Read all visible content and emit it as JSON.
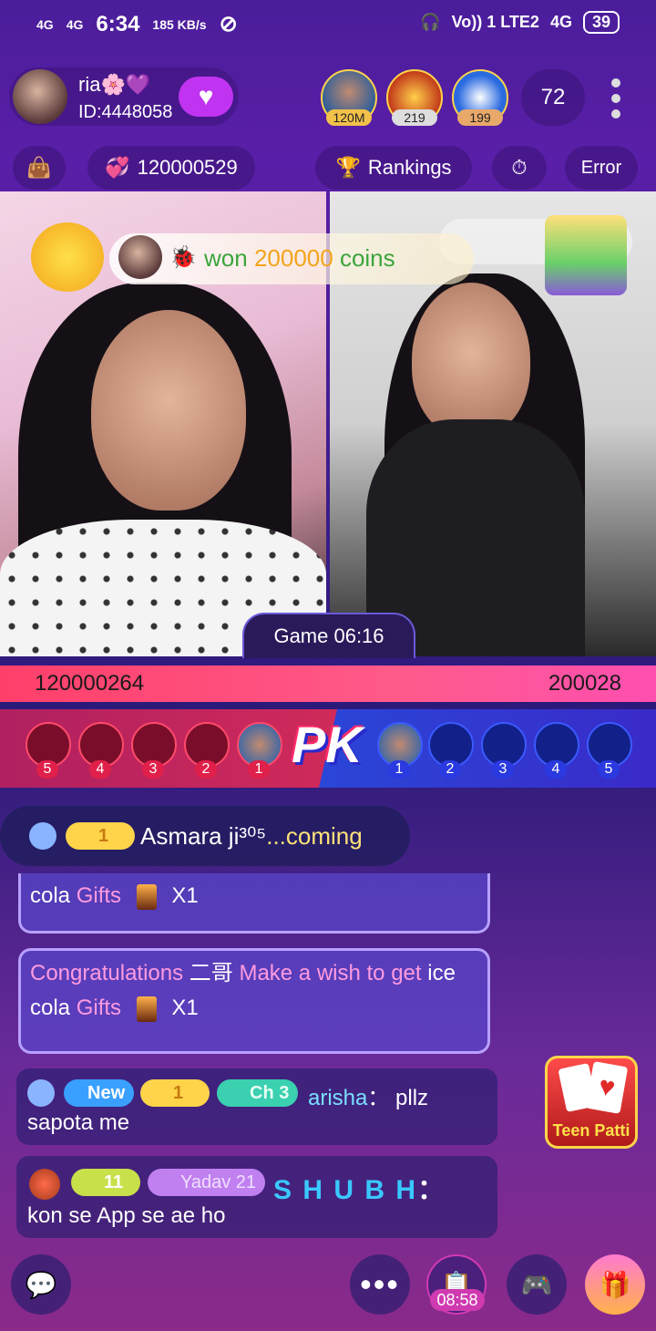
{
  "status_bar": {
    "signal1": "4G",
    "signal2": "4G",
    "time": "6:34",
    "speed": "185 KB/s",
    "network": "Vo)) 1 LTE2",
    "net2": "4G",
    "battery": "39"
  },
  "host": {
    "name": "ria🌸💜",
    "id": "ID:4448058"
  },
  "viewers": [
    {
      "badge": "120M"
    },
    {
      "badge": "219"
    },
    {
      "badge": "199"
    }
  ],
  "viewer_count": "72",
  "toolbar": {
    "coins": "120000529",
    "rankings": "Rankings",
    "error": "Error"
  },
  "banner": {
    "won": "won",
    "amount": "200000",
    "coins": "coins"
  },
  "game_timer": "Game 06:16",
  "scores": {
    "left": "120000264",
    "right": "200028"
  },
  "pk": {
    "logo": "PK",
    "red_seats": [
      "5",
      "4",
      "3",
      "2",
      "1"
    ],
    "blue_seats": [
      "1",
      "2",
      "3",
      "4",
      "5"
    ]
  },
  "join": {
    "level": "1",
    "name": "Asmara ji³⁰⁵",
    "suffix": "...coming"
  },
  "gift1": {
    "text": "cola",
    "gifts": "Gifts",
    "count": "X1"
  },
  "gift2": {
    "congrats": "Congratulations",
    "name": "二哥",
    "wish": "Make a wish to get",
    "ice": "ice",
    "cola": "cola",
    "gifts": "Gifts",
    "count": "X1"
  },
  "msg1": {
    "new": "New",
    "level": "1",
    "ch": "Ch",
    "ch_num": "3",
    "user": "arisha",
    "colon": "：",
    "text1": "pllz",
    "text2": "sapota me"
  },
  "msg2": {
    "level": "11",
    "tag": "Yadav",
    "tag_num": "21",
    "user": "S H U B H",
    "colon": "：",
    "text": "kon se App se ae ho"
  },
  "teen_patti": "Teen Patti",
  "bottom": {
    "timer": "08:58"
  },
  "colors": {
    "accent": "#c033f0",
    "score_bar": "#ff4f8a",
    "pk_red": "#d02a5a",
    "pk_blue": "#2a46d8"
  }
}
